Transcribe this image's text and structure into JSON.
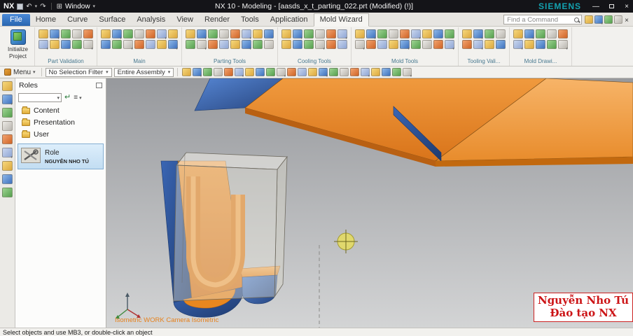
{
  "title_bar": {
    "logo": "NX",
    "window_label": "Window",
    "title": "NX 10 - Modeling - [aasds_x_t_parting_022.prt (Modified)  (!)]",
    "brand": "SIEMENS",
    "icons": {
      "undo": "↶",
      "redo": "↷",
      "window": "⊞",
      "dropdown": "▾",
      "minimize": "—",
      "close": "×"
    }
  },
  "tabs": {
    "file": "File",
    "items": [
      "Home",
      "Curve",
      "Surface",
      "Analysis",
      "View",
      "Render",
      "Tools",
      "Application"
    ],
    "active": "Mold Wizard",
    "search_placeholder": "Find a Command"
  },
  "ribbon": {
    "initialize_line1": "Initialize",
    "initialize_line2": "Project",
    "groups": [
      {
        "label": "Part Validation"
      },
      {
        "label": "Main"
      },
      {
        "label": "Parting Tools"
      },
      {
        "label": "Cooling Tools"
      },
      {
        "label": "Mold Tools"
      },
      {
        "label": "Tooling Vali..."
      },
      {
        "label": "Mold Drawi..."
      }
    ]
  },
  "toolbar": {
    "menu_label": "Menu",
    "selection_filter": "No Selection Filter",
    "scope": "Entire Assembly",
    "dropdown": "▾"
  },
  "roles_panel": {
    "title": "Roles",
    "folders": [
      "Content",
      "Presentation",
      "User"
    ],
    "role_title": "Role",
    "role_name": "NGUYỄN NHO TÚ",
    "icons": {
      "return": "↵",
      "list": "≡",
      "dropdown": "▾"
    }
  },
  "viewport": {
    "view_label": "Isometric WORK Camera Isometric",
    "watermark_line1": "Nguyễn Nho Tú",
    "watermark_line2": "Đào tạo NX",
    "colors": {
      "model_orange": "#e0801c",
      "model_blue": "#2f5fae",
      "crosshair_yellow": "#e8df66",
      "background_top": "#97999d",
      "background_bottom": "#d3d4d5"
    }
  },
  "status_bar": {
    "message": "Select objects and use MB3, or double-click an object"
  }
}
